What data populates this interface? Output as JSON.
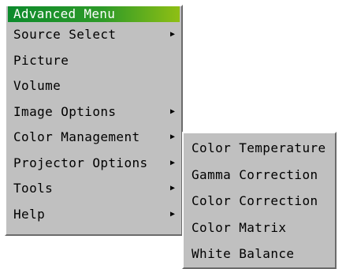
{
  "main_menu": {
    "title": "Advanced Menu",
    "items": [
      {
        "label": "Source Select",
        "arrow": "▶"
      },
      {
        "label": "Picture",
        "arrow": ""
      },
      {
        "label": "Volume",
        "arrow": ""
      },
      {
        "label": "Image Options",
        "arrow": "▶"
      },
      {
        "label": "Color Management",
        "arrow": "▶"
      },
      {
        "label": "Projector Options",
        "arrow": "▶"
      },
      {
        "label": "Tools",
        "arrow": "▶"
      },
      {
        "label": "Help",
        "arrow": "▶"
      }
    ]
  },
  "sub_menu": {
    "items": [
      {
        "label": "Color Temperature"
      },
      {
        "label": "Gamma Correction"
      },
      {
        "label": "Color Correction"
      },
      {
        "label": "Color Matrix"
      },
      {
        "label": "White Balance"
      }
    ]
  },
  "colors": {
    "menu_background": "#c0c0c0",
    "title_gradient_start": "#0c8a2c",
    "title_gradient_end": "#8fbf14",
    "text": "#000000",
    "title_text": "#ffffff"
  },
  "icons": {
    "submenu_arrow": "triangle-right-icon"
  }
}
